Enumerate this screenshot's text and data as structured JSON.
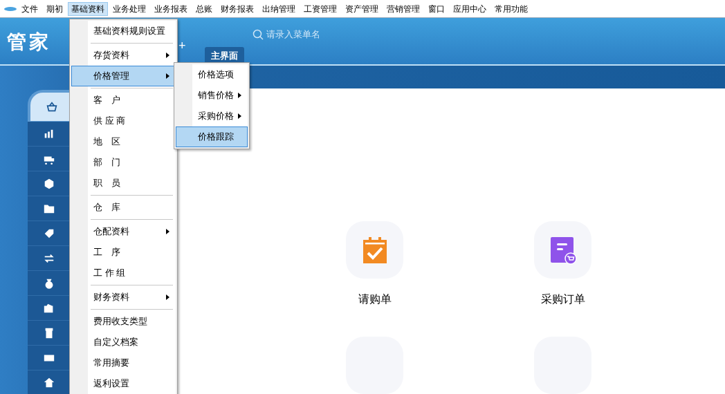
{
  "menubar": [
    {
      "label": "文件",
      "selected": false
    },
    {
      "label": "期初",
      "selected": false
    },
    {
      "label": "基础资料",
      "selected": true
    },
    {
      "label": "业务处理",
      "selected": false
    },
    {
      "label": "业务报表",
      "selected": false
    },
    {
      "label": "总账",
      "selected": false
    },
    {
      "label": "财务报表",
      "selected": false
    },
    {
      "label": "出纳管理",
      "selected": false
    },
    {
      "label": "工资管理",
      "selected": false
    },
    {
      "label": "资产管理",
      "selected": false
    },
    {
      "label": "营销管理",
      "selected": false
    },
    {
      "label": "窗口",
      "selected": false
    },
    {
      "label": "应用中心",
      "selected": false
    },
    {
      "label": "常用功能",
      "selected": false
    }
  ],
  "header": {
    "logo": "管家",
    "search": {
      "placeholder": "请录入菜单名"
    },
    "plus": "+",
    "tabs": [
      {
        "label": "主界面",
        "selected": true
      }
    ]
  },
  "sidebar": {
    "items": [
      {
        "selected": true
      },
      {
        "selected": false
      },
      {
        "selected": false
      },
      {
        "selected": false
      },
      {
        "selected": false
      },
      {
        "selected": false
      },
      {
        "selected": false
      },
      {
        "selected": false
      },
      {
        "selected": false
      },
      {
        "selected": false
      },
      {
        "selected": false
      },
      {
        "selected": false
      }
    ]
  },
  "dropdown": {
    "items": [
      {
        "kind": "item",
        "label": "基础资料规则设置",
        "submenu": false,
        "selected": false
      },
      {
        "kind": "separator"
      },
      {
        "kind": "item",
        "label": "存货资料",
        "submenu": true,
        "selected": false
      },
      {
        "kind": "item",
        "label": "价格管理",
        "submenu": true,
        "selected": true
      },
      {
        "kind": "separator"
      },
      {
        "kind": "item",
        "label": "客　户",
        "submenu": false,
        "selected": false
      },
      {
        "kind": "item",
        "label": "供 应 商",
        "submenu": false,
        "selected": false
      },
      {
        "kind": "item",
        "label": "地　区",
        "submenu": false,
        "selected": false
      },
      {
        "kind": "item",
        "label": "部　门",
        "submenu": false,
        "selected": false
      },
      {
        "kind": "item",
        "label": "职　员",
        "submenu": false,
        "selected": false
      },
      {
        "kind": "separator"
      },
      {
        "kind": "item",
        "label": "仓　库",
        "submenu": false,
        "selected": false
      },
      {
        "kind": "separator"
      },
      {
        "kind": "item",
        "label": "仓配资料",
        "submenu": true,
        "selected": false
      },
      {
        "kind": "item",
        "label": "工　序",
        "submenu": false,
        "selected": false
      },
      {
        "kind": "item",
        "label": "工 作 组",
        "submenu": false,
        "selected": false
      },
      {
        "kind": "separator"
      },
      {
        "kind": "item",
        "label": "财务资料",
        "submenu": true,
        "selected": false
      },
      {
        "kind": "separator"
      },
      {
        "kind": "item",
        "label": "费用收支类型",
        "submenu": false,
        "selected": false
      },
      {
        "kind": "item",
        "label": "自定义档案",
        "submenu": false,
        "selected": false
      },
      {
        "kind": "item",
        "label": "常用摘要",
        "submenu": false,
        "selected": false
      },
      {
        "kind": "item",
        "label": "返利设置",
        "submenu": false,
        "selected": false
      }
    ]
  },
  "submenu": {
    "items": [
      {
        "kind": "item",
        "label": "价格选项",
        "submenu": false,
        "selected": false
      },
      {
        "kind": "item",
        "label": "销售价格",
        "submenu": true,
        "selected": false
      },
      {
        "kind": "item",
        "label": "采购价格",
        "submenu": true,
        "selected": false
      },
      {
        "kind": "item",
        "label": "价格跟踪",
        "submenu": false,
        "selected": true
      }
    ]
  },
  "shortcuts": [
    {
      "kind": "requisition",
      "label": "请购单"
    },
    {
      "kind": "purchase-order",
      "label": "采购订单"
    }
  ]
}
